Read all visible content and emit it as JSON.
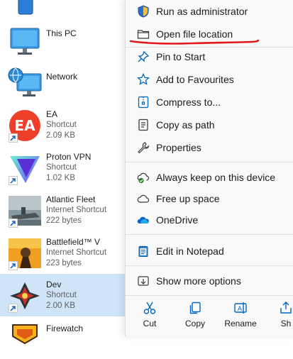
{
  "files": [
    {
      "name": "This PC",
      "type": "",
      "size": "",
      "icon": "this-pc-icon"
    },
    {
      "name": "Network",
      "type": "",
      "size": "",
      "icon": "network-icon"
    },
    {
      "name": "EA",
      "type": "Shortcut",
      "size": "2.09 KB",
      "icon": "ea-app-icon"
    },
    {
      "name": "Proton VPN",
      "type": "Shortcut",
      "size": "1.02 KB",
      "icon": "proton-vpn-icon"
    },
    {
      "name": "Atlantic Fleet",
      "type": "Internet Shortcut",
      "size": "222 bytes",
      "icon": "atlantic-fleet-icon"
    },
    {
      "name": "Battlefield™ V",
      "type": "Internet Shortcut",
      "size": "223 bytes",
      "icon": "battlefield-v-icon"
    },
    {
      "name": "Dev",
      "type": "Shortcut",
      "size": "2.00 KB",
      "icon": "dev-app-icon",
      "selected": true
    },
    {
      "name": "Firewatch",
      "type": "",
      "size": "",
      "icon": "firewatch-icon"
    }
  ],
  "context_menu": {
    "items": [
      {
        "label": "Run as administrator",
        "icon": "shield-icon"
      },
      {
        "label": "Open file location",
        "icon": "folder-icon"
      },
      {
        "label": "Pin to Start",
        "icon": "pin-icon"
      },
      {
        "label": "Add to Favourites",
        "icon": "star-icon"
      },
      {
        "label": "Compress to...",
        "icon": "zip-icon"
      },
      {
        "label": "Copy as path",
        "icon": "copy-path-icon"
      },
      {
        "label": "Properties",
        "icon": "wrench-icon"
      },
      {
        "label": "Always keep on this device",
        "icon": "cloud-sync-icon"
      },
      {
        "label": "Free up space",
        "icon": "cloud-icon"
      },
      {
        "label": "OneDrive",
        "icon": "onedrive-icon"
      },
      {
        "label": "Edit in Notepad",
        "icon": "notepad-icon"
      },
      {
        "label": "Show more options",
        "icon": "show-more-icon"
      }
    ],
    "quick_actions": [
      {
        "label": "Cut",
        "icon": "cut-icon"
      },
      {
        "label": "Copy",
        "icon": "copy-icon"
      },
      {
        "label": "Rename",
        "icon": "rename-icon"
      },
      {
        "label": "Sh",
        "icon": "share-icon"
      }
    ]
  },
  "colors": {
    "selection": "#cfe4f7",
    "accent": "#0067c0",
    "annotation": "#e3161b"
  }
}
